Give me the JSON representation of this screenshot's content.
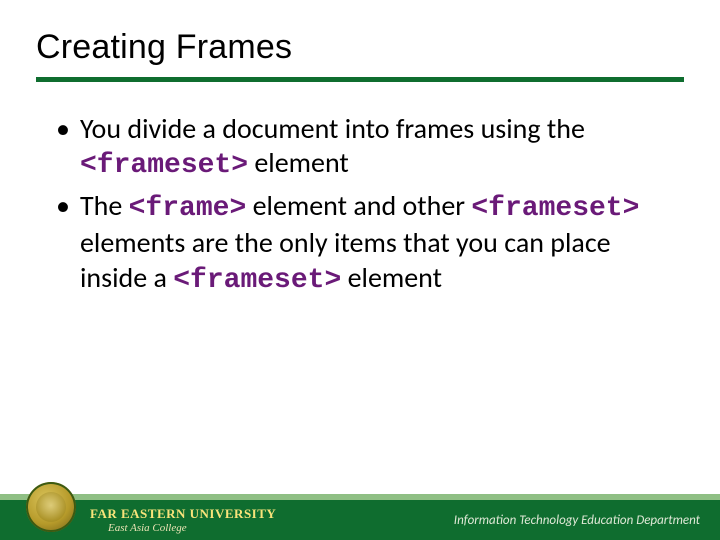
{
  "title": "Creating Frames",
  "bullets": [
    {
      "segments": [
        {
          "t": "You divide a document into frames using the "
        },
        {
          "t": "<frameset>",
          "code": true
        },
        {
          "t": " element"
        }
      ]
    },
    {
      "segments": [
        {
          "t": "The "
        },
        {
          "t": "<frame>",
          "code": true
        },
        {
          "t": " element and other "
        },
        {
          "t": "<frameset>",
          "code": true
        },
        {
          "t": " elements are the only items that you can place inside a "
        },
        {
          "t": "<frameset>",
          "code": true
        },
        {
          "t": " element"
        }
      ]
    }
  ],
  "footer": {
    "university": "FAR EASTERN UNIVERSITY",
    "college": "East Asia College",
    "department": "Information Technology Education Department"
  }
}
